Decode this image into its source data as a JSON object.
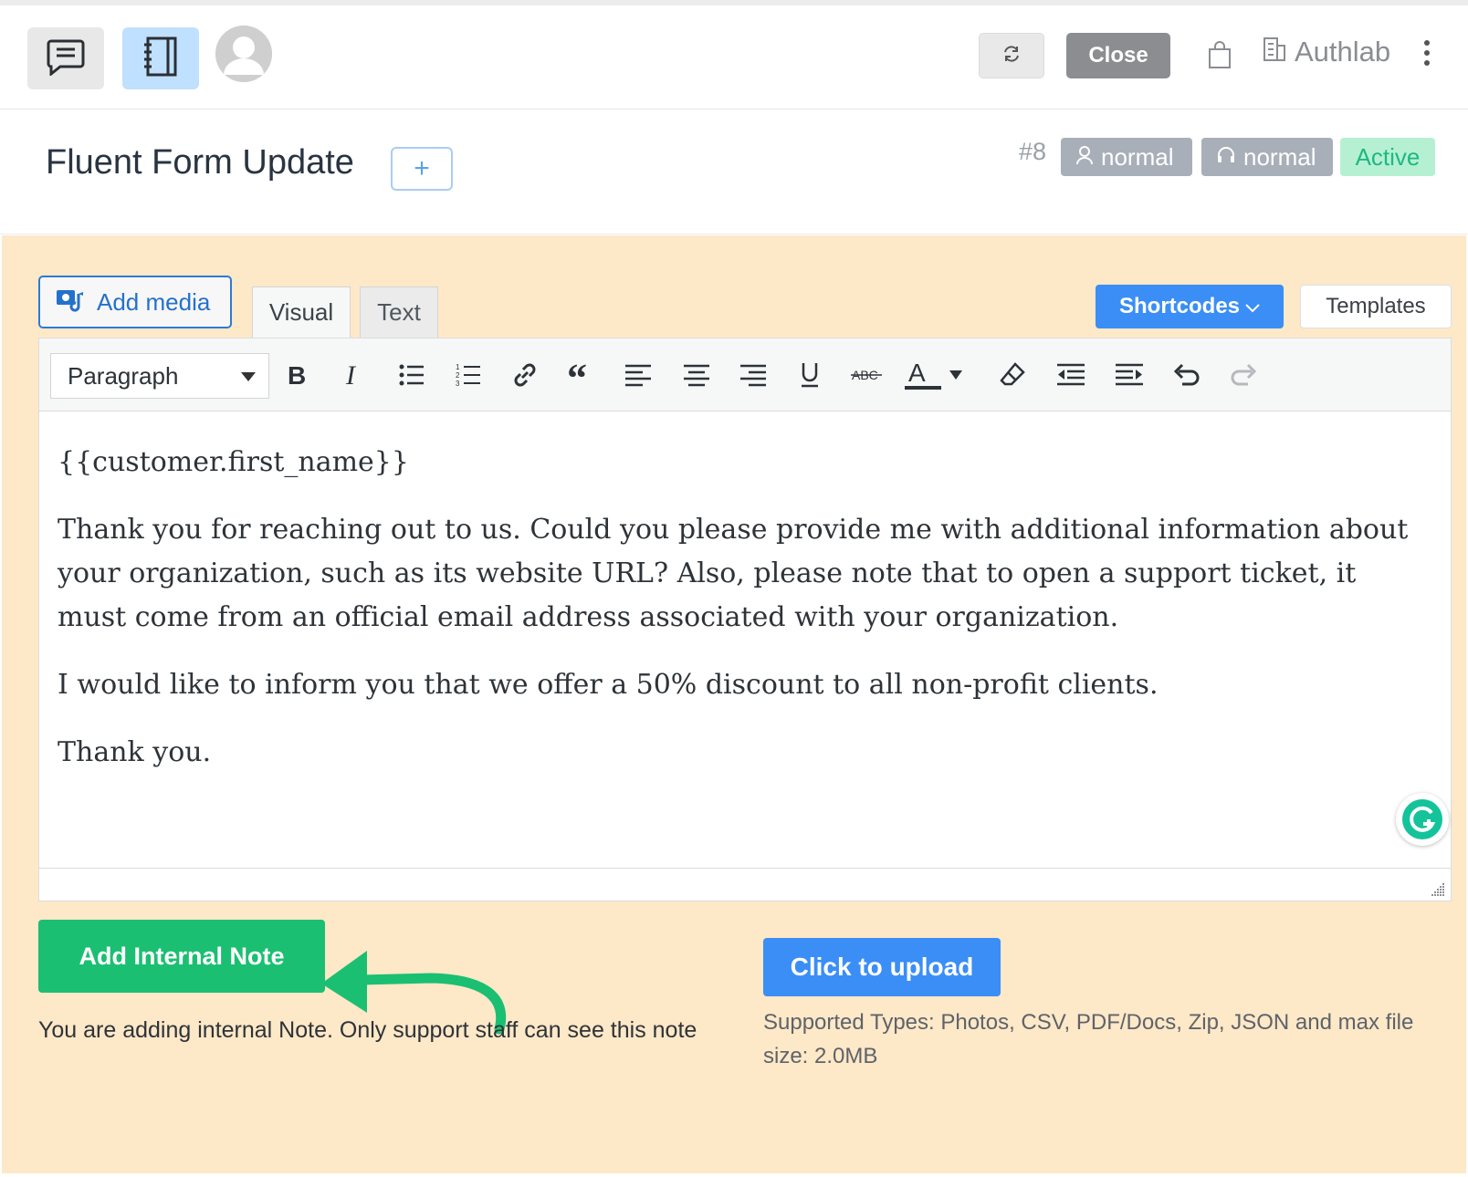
{
  "header": {
    "close_label": "Close",
    "org_name": "Authlab",
    "icons": [
      "chat-icon",
      "notebook-icon",
      "avatar",
      "refresh-icon",
      "shopping-bag-icon",
      "building-icon",
      "more-vertical-icon"
    ]
  },
  "ticket": {
    "title": "Fluent Form Update",
    "add_label": "+",
    "number": "#8",
    "customer_priority": "normal",
    "agent_priority": "normal",
    "status": "Active"
  },
  "editor": {
    "add_media_label": "Add media",
    "tabs": [
      "Visual",
      "Text"
    ],
    "shortcodes_label": "Shortcodes",
    "templates_label": "Templates",
    "format_select": "Paragraph",
    "toolbar_icons": [
      "bold-icon",
      "italic-icon",
      "bullet-list-icon",
      "numbered-list-icon",
      "link-icon",
      "blockquote-icon",
      "align-left-icon",
      "align-center-icon",
      "align-right-icon",
      "underline-icon",
      "strikethrough-icon",
      "text-color-icon",
      "clear-formatting-icon",
      "outdent-icon",
      "indent-icon",
      "undo-icon",
      "redo-icon"
    ],
    "content": [
      "{{customer.first_name}}",
      "Thank you for reaching out to us. Could you please provide me with additional information about your organization, such as its website URL? Also, please note that to open a support ticket, it must come from an official email address associated with your organization.",
      "I would like to inform you that we offer a 50% discount to all non-profit clients.",
      "Thank you."
    ]
  },
  "actions": {
    "add_note_label": "Add Internal Note",
    "note_help": "You are adding internal Note. Only support staff can see this note",
    "upload_label": "Click to upload",
    "upload_help": "Supported Types: Photos, CSV, PDF/Docs, Zip, JSON and max file size: 2.0MB"
  },
  "colors": {
    "primary": "#3a8ef6",
    "success": "#1bbf71",
    "panel_bg": "#fde8c8",
    "badge_grey": "#a8afb8",
    "active_bg": "#b6f0d3"
  }
}
